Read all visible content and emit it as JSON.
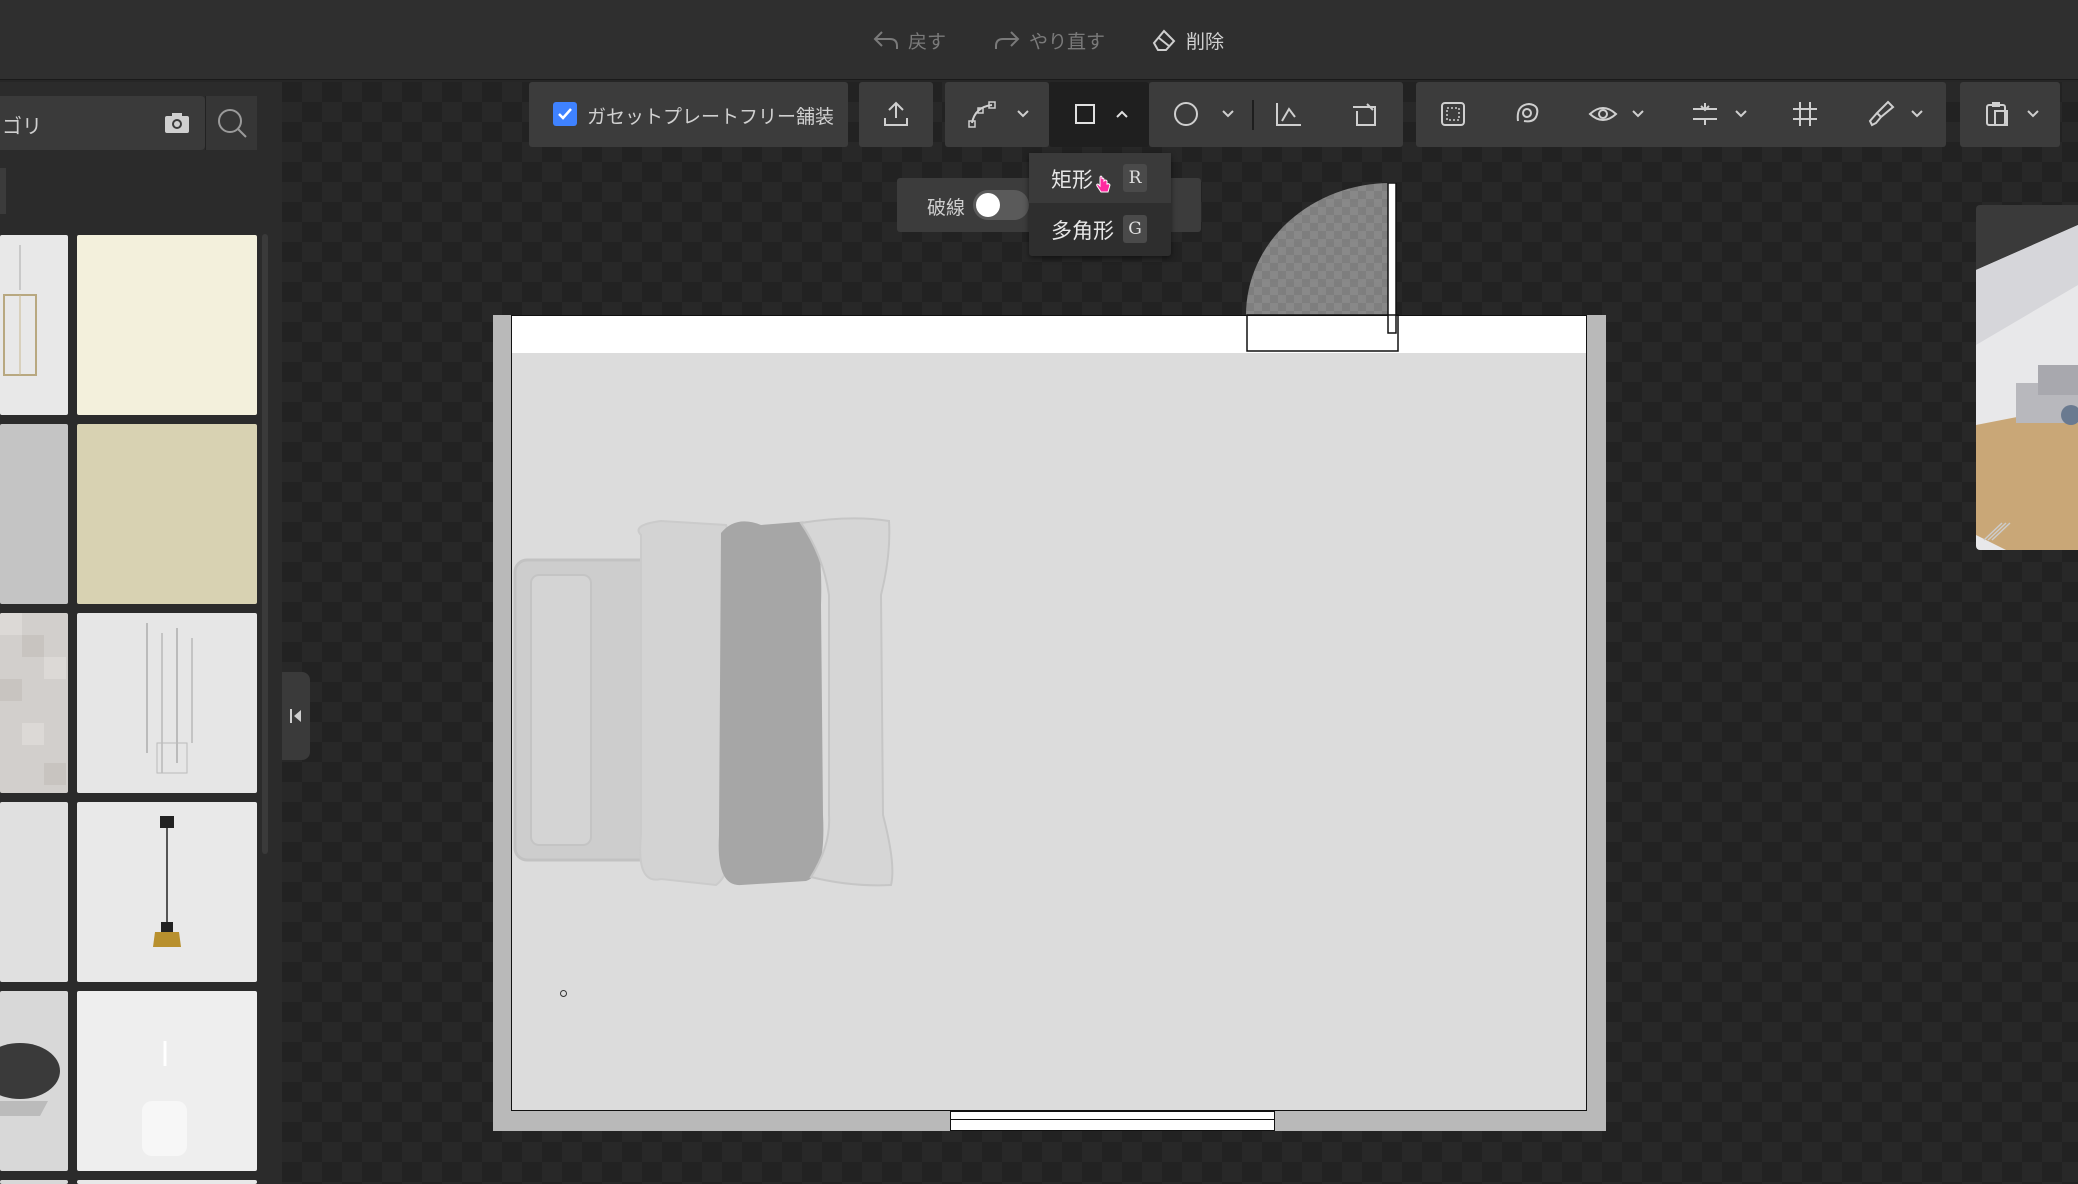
{
  "topbar": {
    "undo_label": "戻す",
    "redo_label": "やり直す",
    "delete_label": "削除"
  },
  "left_panel": {
    "search_text": "ゴリ",
    "search_icon": "search-icon",
    "camera_icon": "camera-icon"
  },
  "toolbar": {
    "gusset_checkbox_label": "ガセットプレートフリー舗装",
    "gusset_checked": true,
    "accent": "#3f82ff"
  },
  "dash_toggle": {
    "label": "破線",
    "on": false
  },
  "shape_dropdown": {
    "items": [
      {
        "label": "矩形",
        "key": "R"
      },
      {
        "label": "多角形",
        "key": "G"
      }
    ]
  },
  "colors": {
    "floor": "#dcdcdc",
    "wall": "#b9b9b9",
    "panel": "#3c3c3c",
    "active_tool": "#1f1f1f"
  }
}
